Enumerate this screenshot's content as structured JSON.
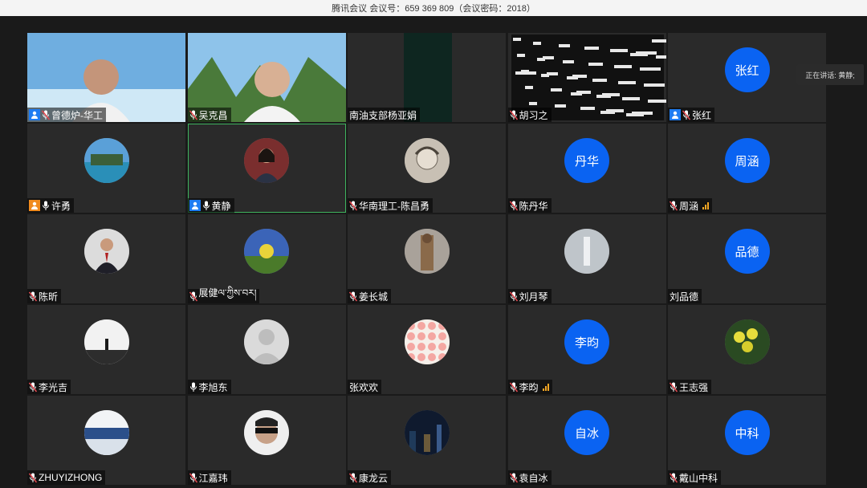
{
  "window": {
    "title": "腾讯会议 会议号：659 369 809（会议密码：2018）"
  },
  "speaking_indicator": "正在讲话: 黄静;",
  "participants": [
    {
      "name": "曾德炉-华工",
      "host": "blue",
      "mic": "muted",
      "kind": "video",
      "scene": "sea"
    },
    {
      "name": "吴克昌",
      "host": "",
      "mic": "muted",
      "kind": "video",
      "scene": "mountain"
    },
    {
      "name": "南油支部杨亚娟",
      "host": "",
      "mic": "none",
      "kind": "video",
      "scene": "dark"
    },
    {
      "name": "胡习之",
      "host": "",
      "mic": "muted",
      "kind": "video",
      "scene": "screen"
    },
    {
      "name": "张红",
      "host": "blue",
      "mic": "muted",
      "kind": "initials",
      "initials": "张红"
    },
    {
      "name": "许勇",
      "host": "orange",
      "mic": "on",
      "kind": "photo",
      "photo": "pool"
    },
    {
      "name": "黄静",
      "host": "blue",
      "mic": "on",
      "kind": "photo",
      "photo": "woman",
      "active": true
    },
    {
      "name": "华南理工-陈昌勇",
      "host": "",
      "mic": "muted",
      "kind": "photo",
      "photo": "sketch"
    },
    {
      "name": "陈丹华",
      "host": "",
      "mic": "muted",
      "kind": "initials",
      "initials": "丹华"
    },
    {
      "name": "周涵",
      "host": "",
      "mic": "muted",
      "kind": "initials",
      "initials": "周涵",
      "signal": true
    },
    {
      "name": "陈昕",
      "host": "",
      "mic": "muted",
      "kind": "photo",
      "photo": "suit"
    },
    {
      "name": "展健ལ་ཀྱིས་བར།",
      "host": "",
      "mic": "muted",
      "kind": "photo",
      "photo": "flower"
    },
    {
      "name": "姜长城",
      "host": "",
      "mic": "muted",
      "kind": "photo",
      "photo": "statue"
    },
    {
      "name": "刘月琴",
      "host": "",
      "mic": "muted",
      "kind": "photo",
      "photo": "mist"
    },
    {
      "name": "刘品德",
      "host": "",
      "mic": "none",
      "kind": "initials",
      "initials": "品德"
    },
    {
      "name": "李光吉",
      "host": "",
      "mic": "muted",
      "kind": "photo",
      "photo": "silhouette"
    },
    {
      "name": "李旭东",
      "host": "",
      "mic": "on",
      "kind": "photo",
      "photo": "default"
    },
    {
      "name": "张欢欢",
      "host": "",
      "mic": "none",
      "kind": "photo",
      "photo": "pattern"
    },
    {
      "name": "李昀",
      "host": "",
      "mic": "muted",
      "kind": "initials",
      "initials": "李昀",
      "signal": true
    },
    {
      "name": "王志强",
      "host": "",
      "mic": "muted",
      "kind": "photo",
      "photo": "orchid"
    },
    {
      "name": "ZHUYIZHONG",
      "host": "",
      "mic": "muted",
      "kind": "photo",
      "photo": "sea-circle"
    },
    {
      "name": "江嘉玮",
      "host": "",
      "mic": "muted",
      "kind": "photo",
      "photo": "sunglasses"
    },
    {
      "name": "康龙云",
      "host": "",
      "mic": "muted",
      "kind": "photo",
      "photo": "city"
    },
    {
      "name": "袁自冰",
      "host": "",
      "mic": "muted",
      "kind": "initials",
      "initials": "自冰"
    },
    {
      "name": "戴山中科",
      "host": "",
      "mic": "muted",
      "kind": "initials",
      "initials": "中科"
    }
  ],
  "colors": {
    "initials_bg": "#0a63f2",
    "host_blue": "#1e7cf2",
    "host_orange": "#f08a1d",
    "muted_red": "#e0484f",
    "active_border": "#3fb45e",
    "signal": "#f5a623"
  }
}
